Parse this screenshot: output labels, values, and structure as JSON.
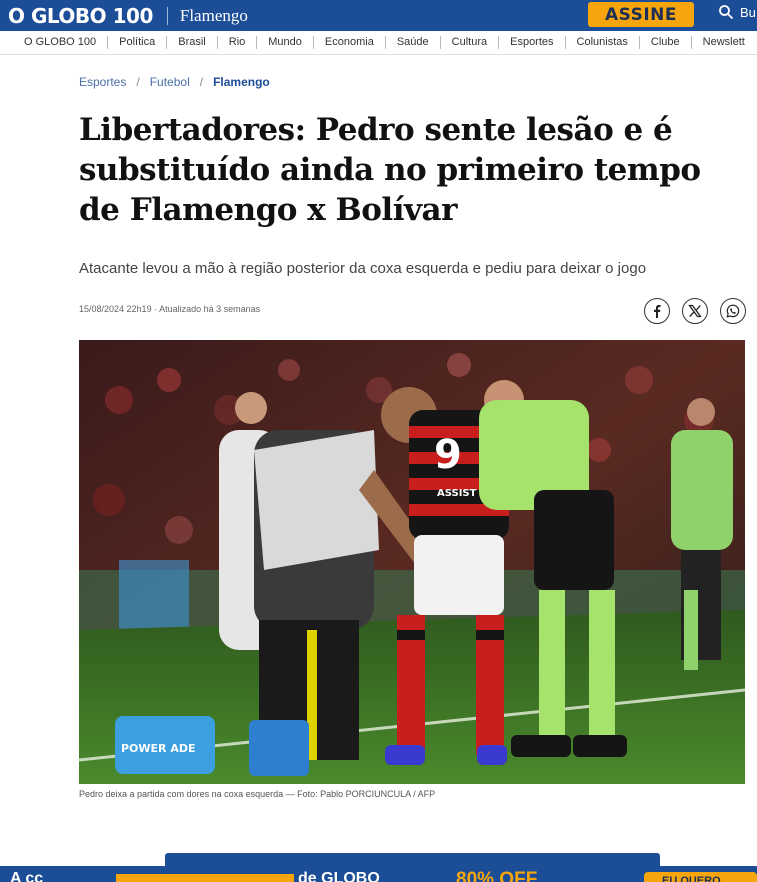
{
  "header": {
    "logo": "O GLOBO 100",
    "section": "Flamengo",
    "subscribe_label": "ASSINE",
    "search_label": "Bu"
  },
  "nav": [
    "O GLOBO 100",
    "Política",
    "Brasil",
    "Rio",
    "Mundo",
    "Economia",
    "Saúde",
    "Cultura",
    "Esportes",
    "Colunistas",
    "Clube",
    "Newslett"
  ],
  "breadcrumb": {
    "items": [
      "Esportes",
      "Futebol"
    ],
    "current": "Flamengo",
    "separator": "/"
  },
  "article": {
    "headline": "Libertadores: Pedro sente lesão e é substituído ainda no primeiro tempo de Flamengo x Bolívar",
    "subtitle": "Atacante levou a mão à região posterior da coxa esquerda e pediu para deixar o jogo",
    "meta": "15/08/2024 22h19 · Atualizado há 3 semanas",
    "photo_caption": "Pedro deixa a partida com dores na coxa esquerda — Foto: Pablo PORCIUNCULA / AFP",
    "photo_text": {
      "jersey_number": "9",
      "jersey_sponsor": "ASSIST CARD",
      "cooler_brand": "POWER ADE"
    }
  },
  "share": [
    "facebook-icon",
    "x-icon",
    "whatsapp-icon"
  ],
  "banner": {
    "text": "A cc",
    "highlight_text": "",
    "brand_text": "de GLOBO",
    "discount_text": "80% OFF",
    "cta_label": "EU QUERO"
  },
  "colors": {
    "brand_blue": "#1c4d97",
    "subscribe_orange": "#f6a60c"
  }
}
